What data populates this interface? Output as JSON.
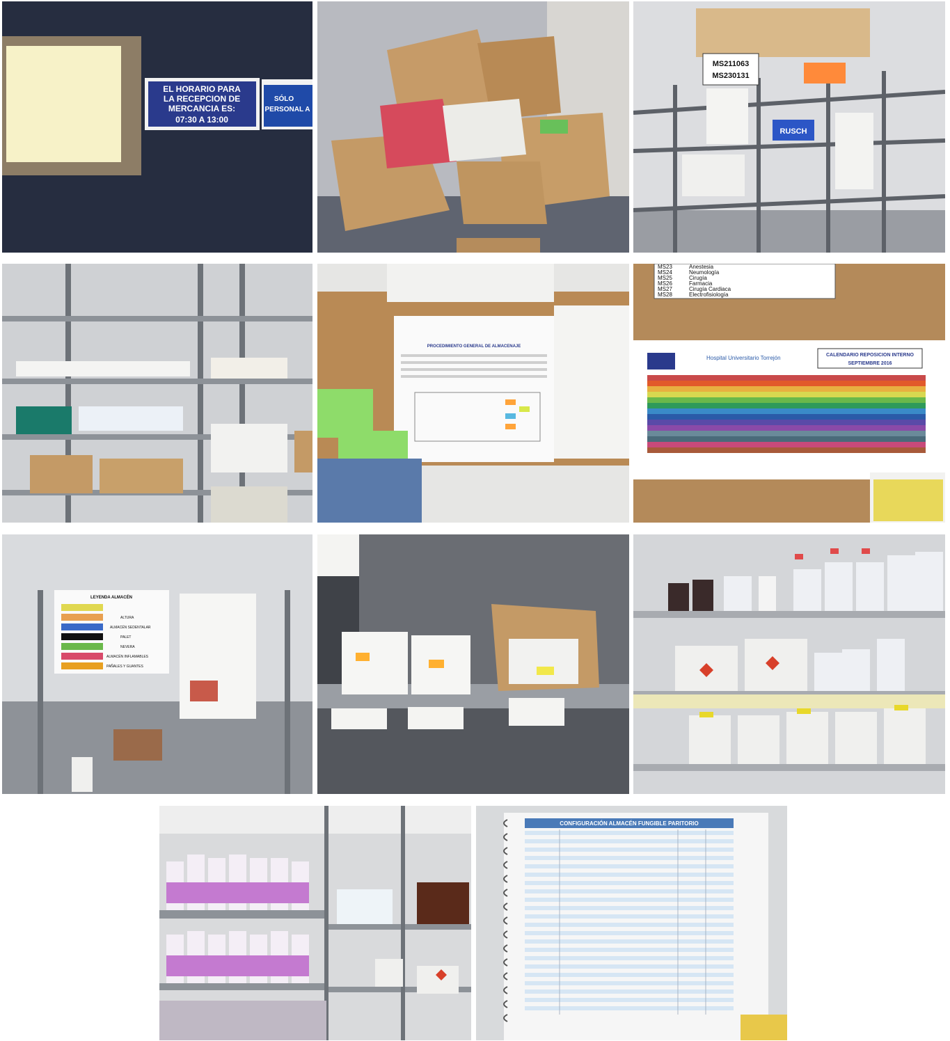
{
  "tiles": [
    {
      "id": "door_sign",
      "sign_lines": [
        "EL HORARIO PARA",
        "LA RECEPCION DE",
        "MERCANCIA ES:",
        "07:30 A 13:00"
      ],
      "second_sign": [
        "SÓLO",
        "PERSONAL A"
      ]
    },
    {
      "id": "boxes"
    },
    {
      "id": "shelving_labels",
      "labels": [
        "MS211063",
        "MS230131"
      ],
      "brand": "RUSCH"
    },
    {
      "id": "shelves_boxes"
    },
    {
      "id": "corkboard",
      "doc_title": "PROCEDIMIENTO GENERAL DE ALMACENAJE"
    },
    {
      "id": "calendar",
      "table_rows": [
        [
          "MS23",
          "Anestesia"
        ],
        [
          "MS24",
          "Neumología"
        ],
        [
          "MS25",
          "Cirugía"
        ],
        [
          "MS26",
          "Farmacia"
        ],
        [
          "MS27",
          "Cirugía Cardiaca"
        ],
        [
          "MS28",
          "Electrofisiología"
        ]
      ],
      "hospital": "Hospital Universitario Torrejón",
      "calendar_title": [
        "CALENDARIO REPOSICION INTERNO",
        "SEPTIEMBRE 2016"
      ]
    },
    {
      "id": "legend_sheet",
      "legend_title": "LEYENDA ALMACÉN",
      "legend_rows": [
        "ALTURA",
        "ALMACÉN SEDENTALAR",
        "PALET",
        "NEVERA",
        "ALMACÉN INFLAMABLES",
        "PAÑALES Y GUANTES"
      ]
    },
    {
      "id": "shelf_boxes_closeup"
    },
    {
      "id": "chemical_bottles"
    },
    {
      "id": "pink_bottles"
    },
    {
      "id": "binder",
      "binder_title": "CONFIGURACIÓN ALMACÉN FUNGIBLE PARITORIO"
    }
  ],
  "colors": {
    "sign_blue": "#2a3a8c",
    "cork": "#b98a55",
    "shelf_grey": "#8a8f96",
    "cardboard": "#c49a66",
    "pink": "#d9a0d6"
  }
}
